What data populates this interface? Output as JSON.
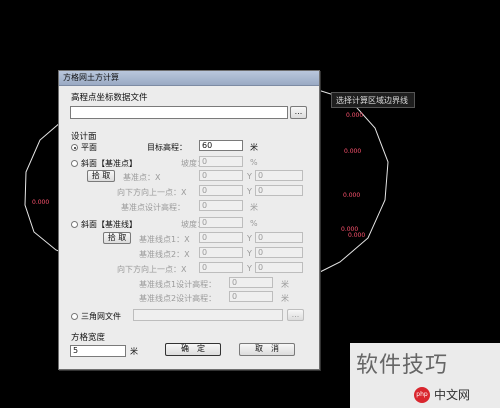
{
  "background": {
    "tooltip": "选择计算区域边界线",
    "labels": [
      "0.000",
      "0.000",
      "0.000",
      "0.000",
      "0.000",
      "0.000"
    ]
  },
  "dialog": {
    "title": "方格网土方计算",
    "elevation_file_label": "高程点坐标数据文件",
    "elevation_file_value": "",
    "browse_label": "...",
    "design_surface_label": "设计面",
    "plane": {
      "label": "平面",
      "target_label": "目标高程：",
      "target_value": "60",
      "unit": "米"
    },
    "slope_point": {
      "label": "斜面【基准点】",
      "slope_label": "坡度：",
      "slope_value": "0",
      "slope_unit": "%",
      "pick_label": "拾 取",
      "base_label": "基准点：X",
      "base_x": "0",
      "base_y_label": "Y",
      "base_y": "0",
      "dir_label": "向下方向上一点：X",
      "dir_x": "0",
      "dir_y_label": "Y",
      "dir_y": "0",
      "design_label": "基准点设计高程：",
      "design_value": "0",
      "design_unit": "米"
    },
    "slope_line": {
      "label": "斜面【基准线】",
      "slope_label": "坡度：",
      "slope_value": "0",
      "slope_unit": "%",
      "pick_label": "拾 取",
      "p1_label": "基准线点1：X",
      "p1_x": "0",
      "p1_y_label": "Y",
      "p1_y": "0",
      "p2_label": "基准线点2：X",
      "p2_x": "0",
      "p2_y_label": "Y",
      "p2_y": "0",
      "dir_label": "向下方向上一点：X",
      "dir_x": "0",
      "dir_y_label": "Y",
      "dir_y": "0",
      "d1_label": "基准线点1设计高程：",
      "d1_value": "0",
      "d1_unit": "米",
      "d2_label": "基准线点2设计高程：",
      "d2_value": "0",
      "d2_unit": "米"
    },
    "tin": {
      "label": "三角网文件",
      "value": "",
      "browse_label": "..."
    },
    "grid_width_label": "方格宽度",
    "grid_width_value": "5",
    "grid_width_unit": "米",
    "ok_label": "确　定",
    "cancel_label": "取　消"
  },
  "watermark": {
    "text": "软件技巧",
    "logo": "php",
    "sub": "中文网"
  }
}
